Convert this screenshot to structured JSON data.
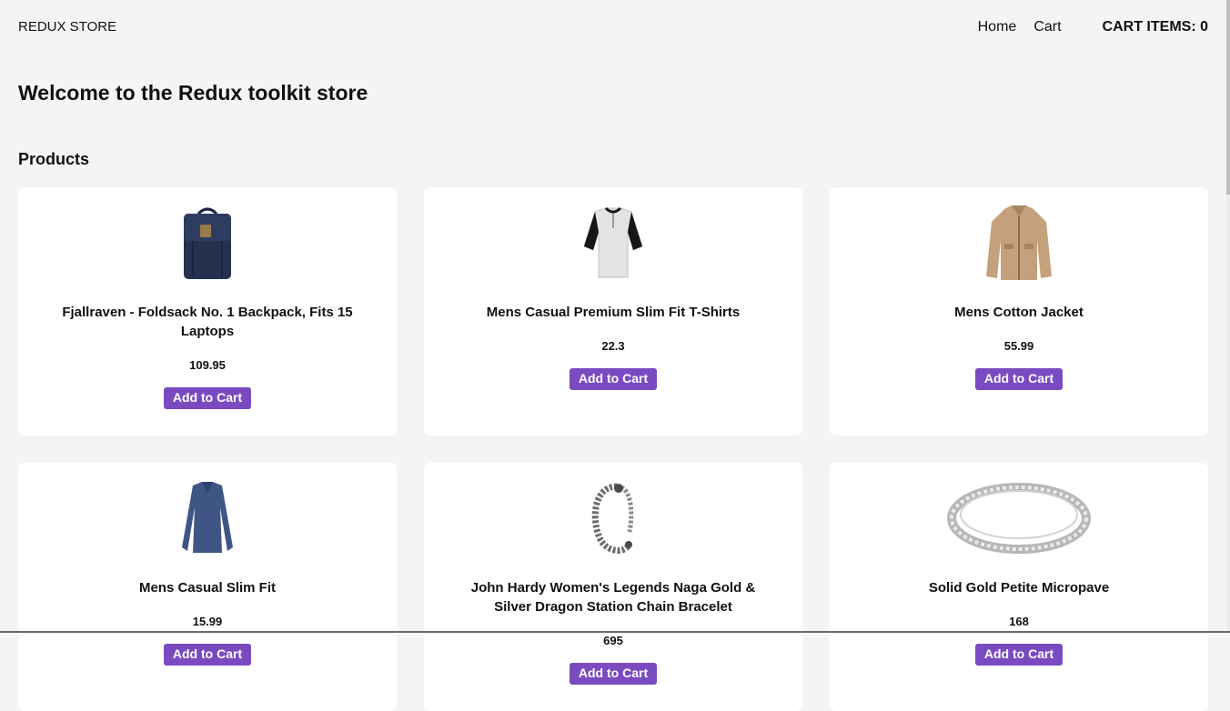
{
  "nav": {
    "brand": "REDUX STORE",
    "links": [
      "Home",
      "Cart"
    ],
    "cart_count_label": "CART ITEMS: 0"
  },
  "page": {
    "title": "Welcome to the Redux toolkit store",
    "section_title": "Products"
  },
  "products": [
    {
      "title": "Fjallraven - Foldsack No. 1 Backpack, Fits 15 Laptops",
      "price": "109.95",
      "button": "Add to Cart",
      "icon": "backpack-icon"
    },
    {
      "title": "Mens Casual Premium Slim Fit T-Shirts",
      "price": "22.3",
      "button": "Add to Cart",
      "icon": "tshirt-icon"
    },
    {
      "title": "Mens Cotton Jacket",
      "price": "55.99",
      "button": "Add to Cart",
      "icon": "jacket-icon"
    },
    {
      "title": "Mens Casual Slim Fit",
      "price": "15.99",
      "button": "Add to Cart",
      "icon": "long-sleeve-shirt-icon"
    },
    {
      "title": "John Hardy Women's Legends Naga Gold & Silver Dragon Station Chain Bracelet",
      "price": "695",
      "button": "Add to Cart",
      "icon": "bracelet-icon"
    },
    {
      "title": "Solid Gold Petite Micropave",
      "price": "168",
      "button": "Add to Cart",
      "icon": "ring-icon"
    }
  ],
  "colors": {
    "background": "#f4f4f4",
    "card": "#ffffff",
    "button": "#7a4bc0",
    "button_text": "#ffffff"
  }
}
